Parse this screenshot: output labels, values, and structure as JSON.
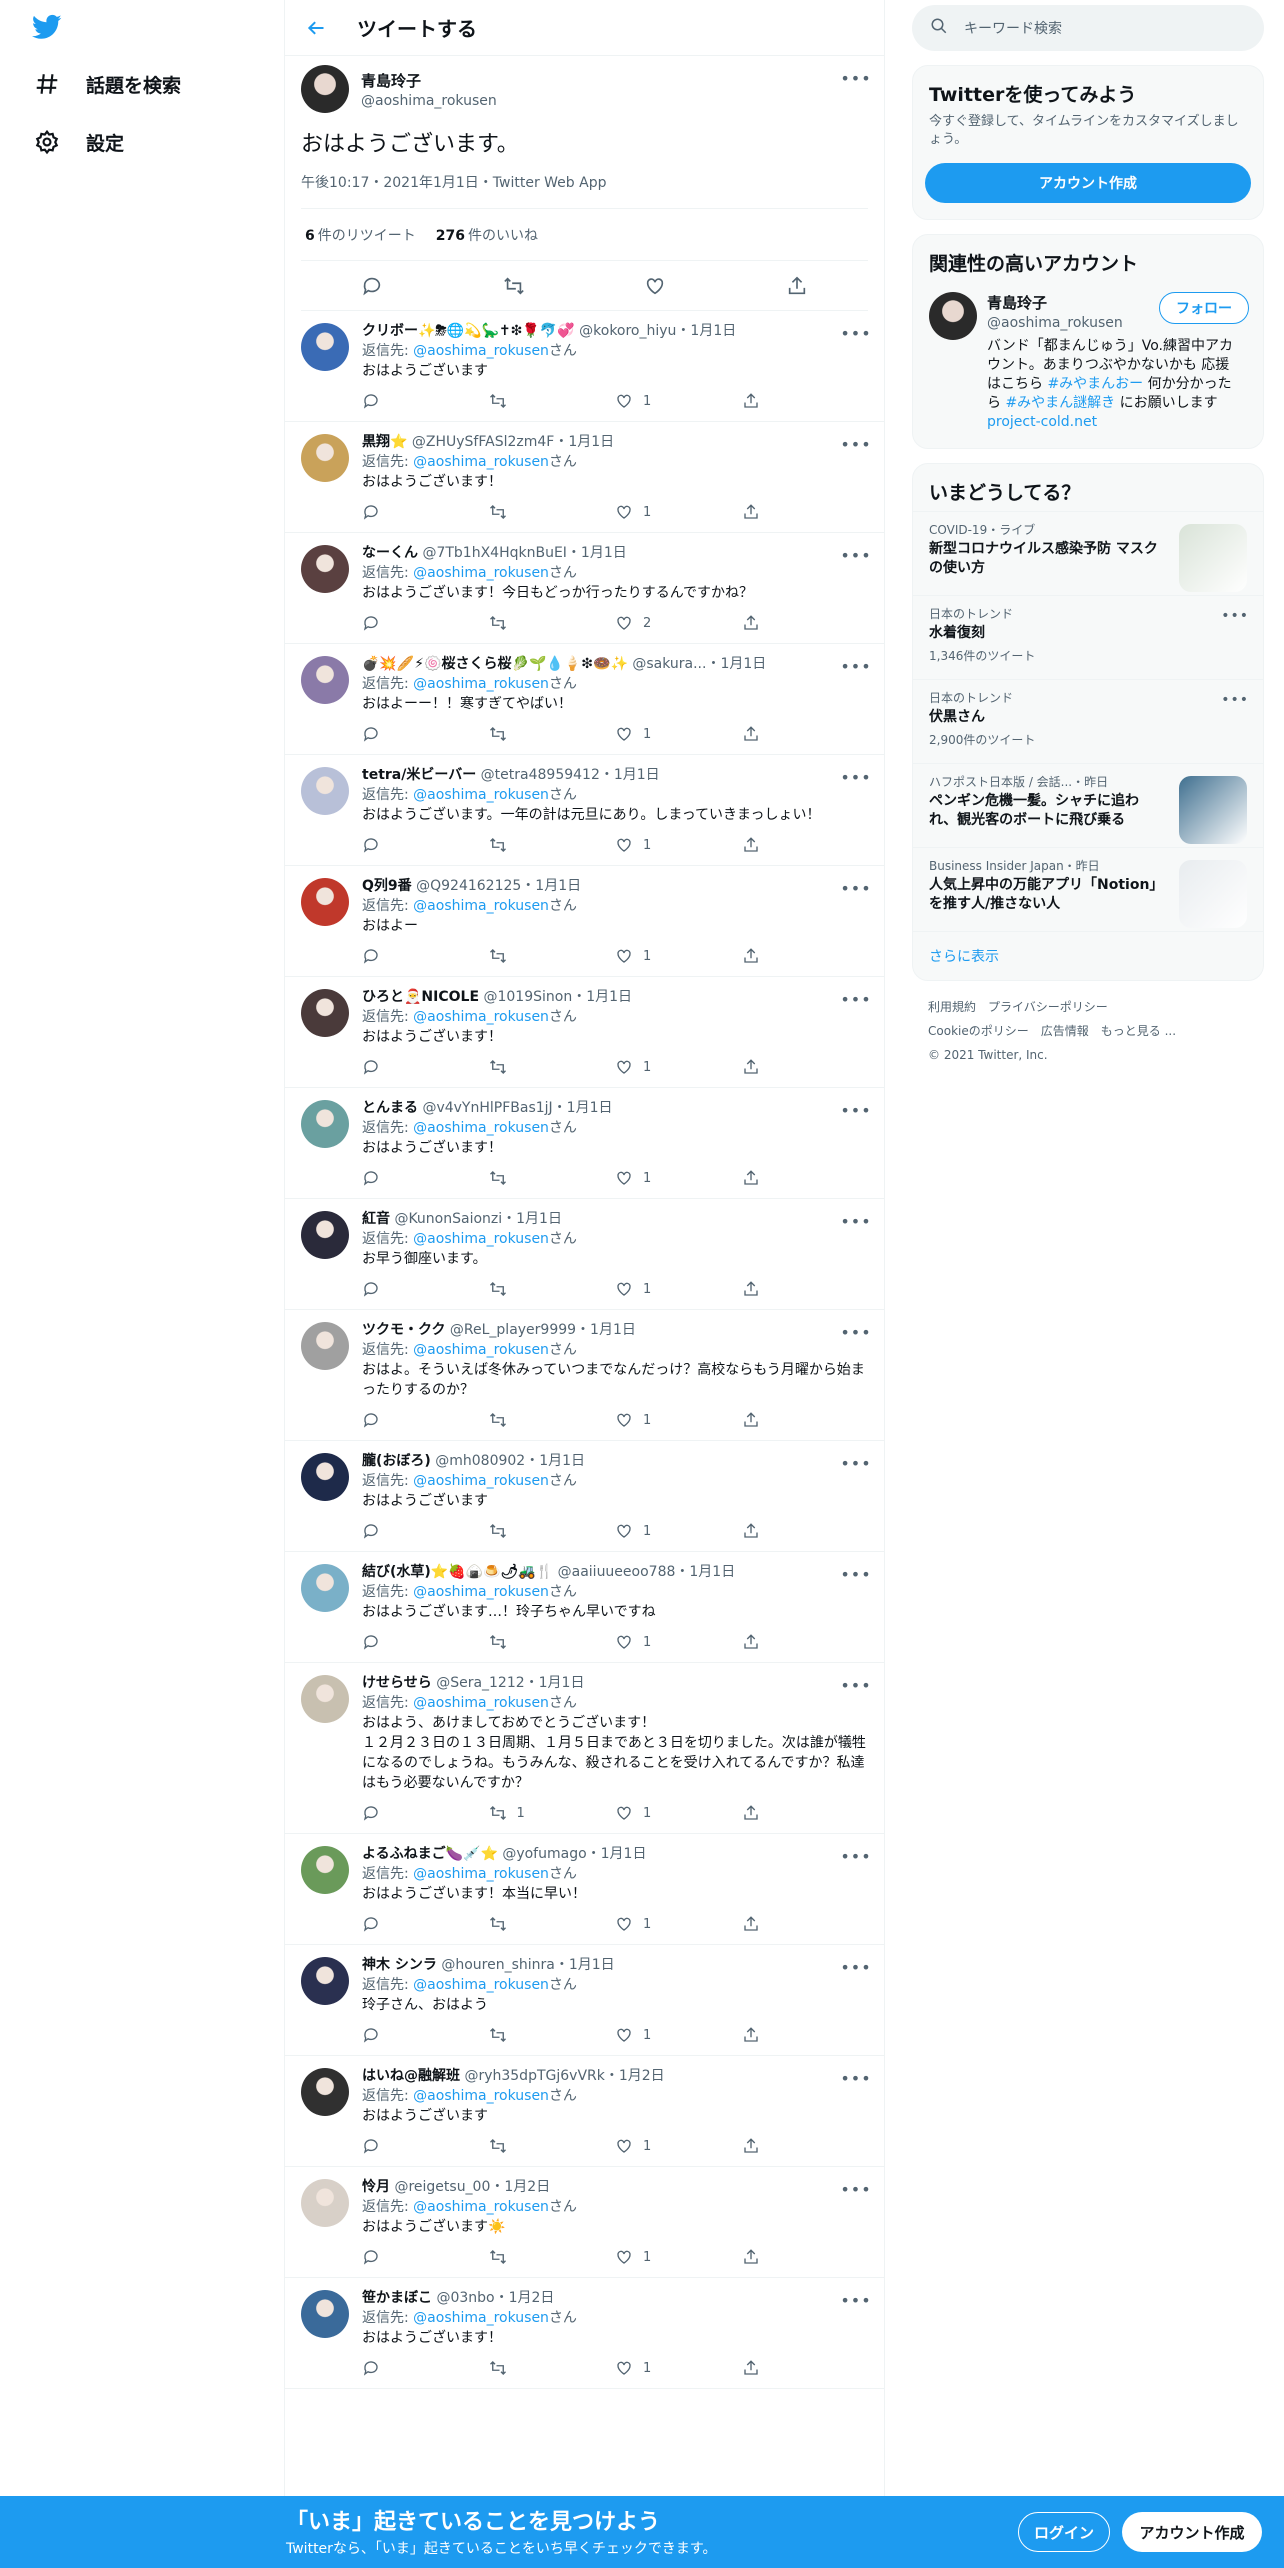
{
  "nav": {
    "explore": "話題を検索",
    "settings": "設定"
  },
  "header": {
    "title": "ツイートする"
  },
  "tweet": {
    "name": "青島玲子",
    "handle": "@aoshima_rokusen",
    "text": "おはようございます。",
    "meta": "午後10:17・2021年1月1日・Twitter Web App",
    "retweets": "6",
    "retweets_label": "件のリツイート",
    "likes": "276",
    "likes_label": "件のいいね"
  },
  "replies": [
    {
      "name": "クリボー✨⛈🌐💫🦕✝❇🌹🐬💞",
      "sub": "@kokoro_hiyu・1月1日",
      "reply_to": "@aoshima_rokusen",
      "san": "さん",
      "text": "おはようございます",
      "rt": "",
      "like": "1",
      "color": "#3a6bb5"
    },
    {
      "name": "黒翔⭐",
      "sub": "@ZHUySfFASl2zm4F・1月1日",
      "reply_to": "@aoshima_rokusen",
      "san": "さん",
      "text": "おはようございます！",
      "rt": "",
      "like": "1",
      "color": "#c9a25a"
    },
    {
      "name": "なーくん",
      "sub": "@7Tb1hX4HqknBuEI・1月1日",
      "reply_to": "@aoshima_rokusen",
      "san": "さん",
      "text": "おはようございます！今日もどっか行ったりするんですかね？",
      "rt": "",
      "like": "2",
      "color": "#5a4040"
    },
    {
      "name": "💣💥🥖⚡🍥桜さくら桜🥬🌱💧🍦❇🍩✨",
      "sub": "@sakura...・1月1日",
      "reply_to": "@aoshima_rokusen",
      "san": "さん",
      "text": "おはよーー！！寒すぎてやばい！",
      "rt": "",
      "like": "1",
      "color": "#8a7aa8"
    },
    {
      "name": "tetra/米ビーバー",
      "sub": "@tetra48959412・1月1日",
      "reply_to": "@aoshima_rokusen",
      "san": "さん",
      "text": "おはようございます。一年の計は元旦にあり。しまっていきまっしょい！",
      "rt": "",
      "like": "1",
      "color": "#b8c0d8"
    },
    {
      "name": "Q列9番",
      "sub": "@Q924162125・1月1日",
      "reply_to": "@aoshima_rokusen",
      "san": "さん",
      "text": "おはよー",
      "rt": "",
      "like": "1",
      "color": "#c0382b"
    },
    {
      "name": "ひろと🎅NICOLE",
      "sub": "@1019Sinon・1月1日",
      "reply_to": "@aoshima_rokusen",
      "san": "さん",
      "text": "おはようございます！",
      "rt": "",
      "like": "1",
      "color": "#4a3a3a"
    },
    {
      "name": "とんまる",
      "sub": "@v4vYnHlPFBas1jJ・1月1日",
      "reply_to": "@aoshima_rokusen",
      "san": "さん",
      "text": "おはようございます！",
      "rt": "",
      "like": "1",
      "color": "#6aa0a0"
    },
    {
      "name": "紅音",
      "sub": "@KunonSaionzi・1月1日",
      "reply_to": "@aoshima_rokusen",
      "san": "さん",
      "text": "お早う御座います。",
      "rt": "",
      "like": "1",
      "color": "#2a2a3a"
    },
    {
      "name": "ツクモ・クク",
      "sub": "@ReL_player9999・1月1日",
      "reply_to": "@aoshima_rokusen",
      "san": "さん",
      "text": "おはよ。そういえば冬休みっていつまでなんだっけ？高校ならもう月曜から始まったりするのか？",
      "rt": "",
      "like": "1",
      "color": "#a0a0a0"
    },
    {
      "name": "朧(おぼろ)",
      "sub": "@mh080902・1月1日",
      "reply_to": "@aoshima_rokusen",
      "san": "さん",
      "text": "おはようございます",
      "rt": "",
      "like": "1",
      "color": "#1e2a4a"
    },
    {
      "name": "結び(水草)⭐🍓🍙🍮🌶🚜🍴",
      "sub": "@aaiiuueeoo788・1月1日",
      "reply_to": "@aoshima_rokusen",
      "san": "さん",
      "text": "おはようございます…！玲子ちゃん早いですね",
      "rt": "",
      "like": "1",
      "color": "#7ab0c8"
    },
    {
      "name": "けせらせら",
      "sub": "@Sera_1212・1月1日",
      "reply_to": "@aoshima_rokusen",
      "san": "さん",
      "text": "おはよう、あけましておめでとうございます！\n１２月２３日の１３日周期、１月５日まであと３日を切りました。次は誰が犠牲になるのでしょうね。もうみんな、殺されることを受け入れてるんですか？私達はもう必要ないんですか？",
      "rt": "1",
      "like": "1",
      "color": "#c8c0b0"
    },
    {
      "name": "よるふねまご🍆💉⭐",
      "sub": "@yofumago・1月1日",
      "reply_to": "@aoshima_rokusen",
      "san": "さん",
      "text": "おはようございます！本当に早い！",
      "rt": "",
      "like": "1",
      "color": "#6a9a5a"
    },
    {
      "name": "神木 シンラ",
      "sub": "@houren_shinra・1月1日",
      "reply_to": "@aoshima_rokusen",
      "san": "さん",
      "text": "玲子さん、おはよう",
      "rt": "",
      "like": "1",
      "color": "#2a3050"
    },
    {
      "name": "はいね@融解班",
      "sub": "@ryh35dpTGj6vVRk・1月2日",
      "reply_to": "@aoshima_rokusen",
      "san": "さん",
      "text": "おはようございます",
      "rt": "",
      "like": "1",
      "color": "#303030"
    },
    {
      "name": "怜月",
      "sub": "@reigetsu_00・1月2日",
      "reply_to": "@aoshima_rokusen",
      "san": "さん",
      "text": "おはようございます☀️",
      "rt": "",
      "like": "1",
      "color": "#d8d0c8"
    },
    {
      "name": "笹かまぼこ",
      "sub": "@03nbo・1月2日",
      "reply_to": "@aoshima_rokusen",
      "san": "さん",
      "text": "おはようございます！",
      "rt": "",
      "like": "1",
      "color": "#3a6a9a"
    }
  ],
  "search": {
    "placeholder": "キーワード検索"
  },
  "signup": {
    "title": "Twitterを使ってみよう",
    "desc": "今すぐ登録して、タイムラインをカスタマイズしましょう。",
    "button": "アカウント作成"
  },
  "related": {
    "title": "関連性の高いアカウント",
    "name": "青島玲子",
    "handle": "@aoshima_rokusen",
    "follow": "フォロー",
    "bio_a": "バンド「都まんじゅう」Vo.練習中アカウント。あまりつぶやかないかも 応援はこちら ",
    "tag1": "#みやまんおー",
    "bio_b": " 何か分かったら ",
    "tag2": "#みやまん謎解き",
    "bio_c": " にお願いします ",
    "link": "project-cold.net"
  },
  "trends": {
    "title": "いまどうしてる？",
    "items": [
      {
        "cat": "COVID-19・ライブ",
        "title": "新型コロナウイルス感染予防 マスクの使い方",
        "count": "",
        "thumb": "#d9e3d8"
      },
      {
        "cat": "日本のトレンド",
        "title": "水着復刻",
        "count": "1,346件のツイート",
        "thumb": ""
      },
      {
        "cat": "日本のトレンド",
        "title": "伏黒さん",
        "count": "2,900件のツイート",
        "thumb": ""
      },
      {
        "cat": "ハフポスト日本版 / 会話...・昨日",
        "title": "ペンギン危機一髪。シャチに追われ、観光客のボートに飛び乗る",
        "count": "",
        "thumb": "#3f6f8f"
      },
      {
        "cat": "Business Insider Japan・昨日",
        "title": "人気上昇中の万能アプリ「Notion」を推す人/推さない人",
        "count": "",
        "thumb": "#e8ecef"
      }
    ],
    "show_more": "さらに表示"
  },
  "footer": {
    "terms": "利用規約",
    "privacy": "プライバシーポリシー",
    "cookie": "Cookieのポリシー",
    "ads": "広告情報",
    "more": "もっと見る ...",
    "copy": "© 2021 Twitter, Inc."
  },
  "banner": {
    "title": "「いま」起きていることを見つけよう",
    "sub": "Twitterなら、「いま」起きていることをいち早くチェックできます。",
    "login": "ログイン",
    "signup": "アカウント作成"
  }
}
